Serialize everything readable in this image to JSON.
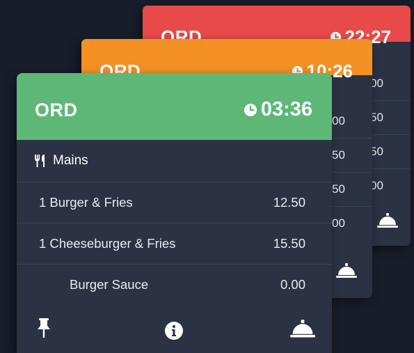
{
  "back_card_3": {
    "label": "ORD",
    "time": "22:27",
    "color": "#e84a4a",
    "partial_prices": [
      "00",
      "50",
      "50",
      "00"
    ]
  },
  "back_card_2": {
    "label": "ORD",
    "time": "10:26",
    "color": "#f39125",
    "partial_prices": [
      "00",
      "50",
      "50",
      "00"
    ]
  },
  "front_card": {
    "label": "ORD",
    "time": "03:36",
    "color": "#5db877",
    "section": {
      "icon": "fork-knife-icon",
      "title": "Mains"
    },
    "items": [
      {
        "name": "1 Burger & Fries",
        "price": "12.50"
      },
      {
        "name": "1 Cheeseburger & Fries",
        "price": "15.50"
      }
    ],
    "modifier": {
      "name": "Burger Sauce",
      "price": "0.00"
    },
    "footer_icons": [
      "pin-icon",
      "info-icon",
      "bell-icon"
    ]
  }
}
